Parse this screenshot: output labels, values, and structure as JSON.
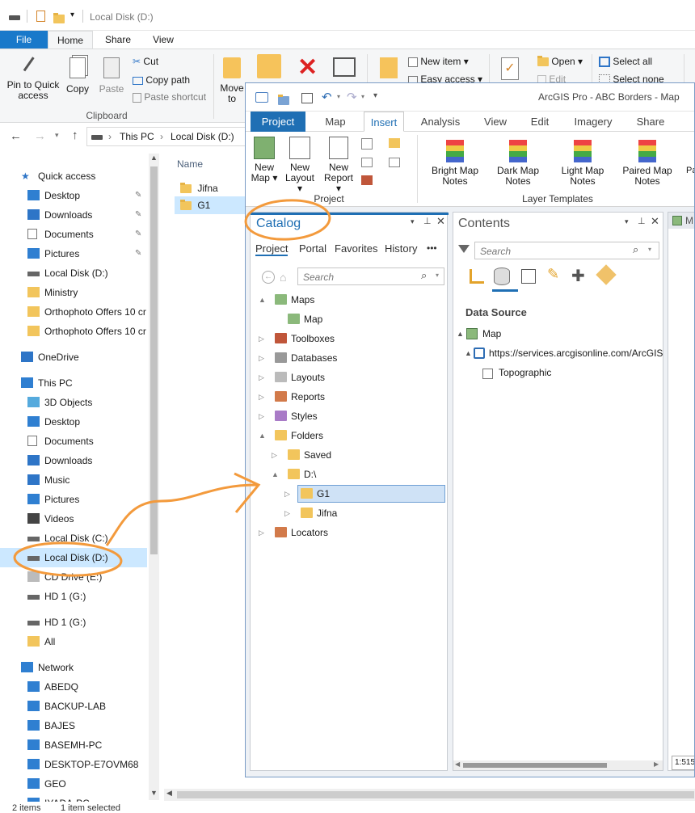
{
  "explorer": {
    "title": "Local Disk (D:)",
    "tabs": [
      "File",
      "Home",
      "Share",
      "View"
    ],
    "ribbon": {
      "pin_label": "Pin to Quick access",
      "copy_label": "Copy",
      "paste_label": "Paste",
      "cut_label": "Cut",
      "copy_path_label": "Copy path",
      "paste_shortcut_label": "Paste shortcut",
      "clipboard_group": "Clipboard",
      "move_label": "Move to",
      "new_item_label": "New item",
      "easy_access_label": "Easy access",
      "open_label": "Open",
      "edit_label": "Edit",
      "select_all_label": "Select all",
      "select_none_label": "Select none"
    },
    "address": {
      "this_pc": "This PC",
      "sep": "›",
      "drive": "Local Disk (D:)"
    },
    "nav": [
      {
        "label": "Quick access",
        "icon": "star-icon"
      },
      {
        "label": "Desktop",
        "icon": "desktop-icon",
        "pinned": true
      },
      {
        "label": "Downloads",
        "icon": "download-icon",
        "pinned": true
      },
      {
        "label": "Documents",
        "icon": "document-icon",
        "pinned": true
      },
      {
        "label": "Pictures",
        "icon": "pictures-icon",
        "pinned": true
      },
      {
        "label": "Local Disk (D:)",
        "icon": "drive-icon"
      },
      {
        "label": "Ministry",
        "icon": "folder-icon"
      },
      {
        "label": "Orthophoto Offers 10 cr",
        "icon": "folder-icon"
      },
      {
        "label": "Orthophoto Offers 10 cr",
        "icon": "folder-icon"
      },
      {
        "label": "OneDrive",
        "icon": "cloud-icon"
      },
      {
        "label": "This PC",
        "icon": "computer-icon"
      },
      {
        "label": "3D Objects",
        "icon": "cube-icon"
      },
      {
        "label": "Desktop",
        "icon": "desktop-icon"
      },
      {
        "label": "Documents",
        "icon": "document-icon"
      },
      {
        "label": "Downloads",
        "icon": "download-icon"
      },
      {
        "label": "Music",
        "icon": "music-icon"
      },
      {
        "label": "Pictures",
        "icon": "pictures-icon"
      },
      {
        "label": "Videos",
        "icon": "video-icon"
      },
      {
        "label": "Local Disk (C:)",
        "icon": "drive-icon"
      },
      {
        "label": "Local Disk (D:)",
        "icon": "drive-icon",
        "selected": true
      },
      {
        "label": "CD Drive (E:)",
        "icon": "cd-icon"
      },
      {
        "label": "HD 1 (G:)",
        "icon": "drive-icon"
      },
      {
        "label": "HD 1 (G:)",
        "icon": "drive-icon"
      },
      {
        "label": "All",
        "icon": "folder-icon"
      },
      {
        "label": "Network",
        "icon": "network-icon"
      },
      {
        "label": "ABEDQ",
        "icon": "monitor-icon"
      },
      {
        "label": "BACKUP-LAB",
        "icon": "monitor-icon"
      },
      {
        "label": "BAJES",
        "icon": "monitor-icon"
      },
      {
        "label": "BASEMH-PC",
        "icon": "monitor-icon"
      },
      {
        "label": "DESKTOP-E7OVM68",
        "icon": "monitor-icon"
      },
      {
        "label": "GEO",
        "icon": "monitor-icon"
      },
      {
        "label": "IYADA-PC",
        "icon": "monitor-icon"
      }
    ],
    "content": {
      "column_name": "Name",
      "items": [
        {
          "name": "Jifna",
          "selected": false
        },
        {
          "name": "G1",
          "selected": true
        }
      ]
    },
    "status": {
      "items": "2 items",
      "selected": "1 item selected"
    }
  },
  "arcgis": {
    "title": "ArcGIS Pro - ABC Borders - Map",
    "tabs": [
      "Project",
      "Map",
      "Insert",
      "Analysis",
      "View",
      "Edit",
      "Imagery",
      "Share"
    ],
    "active_tab": "Insert",
    "ribbon": {
      "new_map": "New Map",
      "new_layout": "New Layout",
      "new_report": "New Report",
      "project_group": "Project",
      "templates": [
        "Bright Map Notes",
        "Dark Map Notes",
        "Light Map Notes",
        "Paired Map Notes"
      ],
      "templates_overflow": "Pa",
      "layer_templates_group": "Layer Templates"
    },
    "catalog": {
      "title": "Catalog",
      "subtabs": [
        "Project",
        "Portal",
        "Favorites",
        "History"
      ],
      "more": "•••",
      "search_placeholder": "Search",
      "tree": [
        {
          "label": "Maps",
          "level": 0,
          "caret": "▲"
        },
        {
          "label": "Map",
          "level": 1,
          "caret": ""
        },
        {
          "label": "Toolboxes",
          "level": 0,
          "caret": "▷"
        },
        {
          "label": "Databases",
          "level": 0,
          "caret": "▷"
        },
        {
          "label": "Layouts",
          "level": 0,
          "caret": "▷"
        },
        {
          "label": "Reports",
          "level": 0,
          "caret": "▷"
        },
        {
          "label": "Styles",
          "level": 0,
          "caret": "▷"
        },
        {
          "label": "Folders",
          "level": 0,
          "caret": "▲"
        },
        {
          "label": "Saved",
          "level": 1,
          "caret": "▷"
        },
        {
          "label": "D:\\",
          "level": 1,
          "caret": "▲"
        },
        {
          "label": "G1",
          "level": 2,
          "caret": "▷",
          "selected": true
        },
        {
          "label": "Jifna",
          "level": 2,
          "caret": "▷"
        },
        {
          "label": "Locators",
          "level": 0,
          "caret": "▷"
        }
      ]
    },
    "contents": {
      "title": "Contents",
      "search_placeholder": "Search",
      "data_source": "Data Source",
      "map": "Map",
      "url": "https://services.arcgisonline.com/ArcGIS",
      "layer": "Topographic"
    },
    "map_tab_label": "M",
    "scale": "1:515"
  },
  "colors": {
    "accent": "#2b5797",
    "file_tab": "#1979ca",
    "annotation": "#f39a3c",
    "selection": "#cce8ff",
    "arcgis_blue": "#1f6fb4"
  }
}
